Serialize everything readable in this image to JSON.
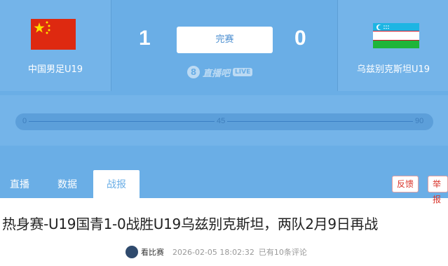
{
  "match": {
    "home": {
      "name": "中国男足U19",
      "score": "1",
      "flag_icon": "china-flag-icon"
    },
    "away": {
      "name": "乌兹别克斯坦U19",
      "score": "0",
      "flag_icon": "uzbekistan-flag-icon"
    },
    "status": "完赛"
  },
  "brand": {
    "logo_char": "8",
    "name": "直播吧",
    "live_badge": "LIVE"
  },
  "timeline": {
    "ticks": [
      "0",
      "45",
      "90"
    ]
  },
  "tabs": [
    {
      "label": "直播",
      "active": false
    },
    {
      "label": "数据",
      "active": false
    },
    {
      "label": "战报",
      "active": true
    }
  ],
  "actions": {
    "feedback": "反馈",
    "report": "举报"
  },
  "article": {
    "title": "热身赛-U19国青1-0战胜U19乌兹别克斯坦，两队2月9日再战",
    "source": "看比赛",
    "timestamp": "2026-02-05 18:02:32",
    "comments": "已有10条评论"
  },
  "colors": {
    "hero_bg": "#6aaee6",
    "panel_bg": "#74b4e9",
    "report_red": "#d9352c"
  }
}
